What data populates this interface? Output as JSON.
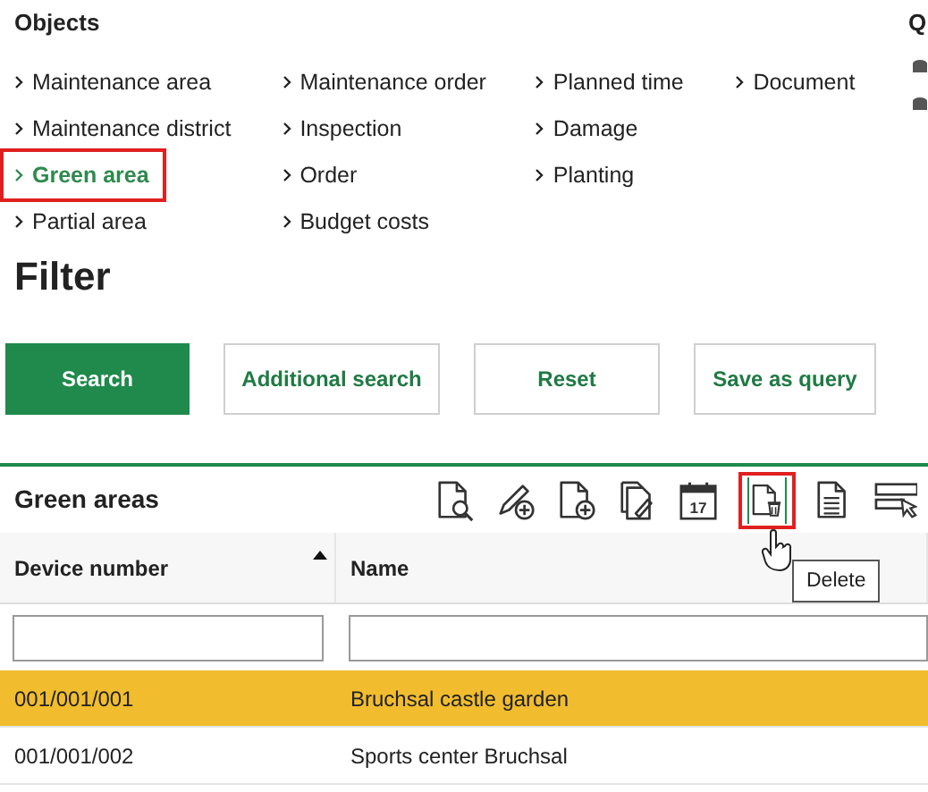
{
  "objects": {
    "heading": "Objects",
    "link_columns": [
      [
        {
          "label": "Maintenance area",
          "selected": false
        },
        {
          "label": "Maintenance district",
          "selected": false
        },
        {
          "label": "Green area",
          "selected": true
        },
        {
          "label": "Partial area",
          "selected": false
        }
      ],
      [
        {
          "label": "Maintenance order",
          "selected": false
        },
        {
          "label": "Inspection",
          "selected": false
        },
        {
          "label": "Order",
          "selected": false
        },
        {
          "label": "Budget costs",
          "selected": false
        }
      ],
      [
        {
          "label": "Planned time",
          "selected": false
        },
        {
          "label": "Damage",
          "selected": false
        },
        {
          "label": "Planting",
          "selected": false
        }
      ],
      [
        {
          "label": "Document",
          "selected": false
        }
      ]
    ]
  },
  "side_heading": "Q",
  "filter": {
    "title": "Filter",
    "buttons": [
      {
        "label": "Search",
        "kind": "primary"
      },
      {
        "label": "Additional search",
        "kind": "secondary"
      },
      {
        "label": "Reset",
        "kind": "secondary"
      },
      {
        "label": "Save as query",
        "kind": "secondary"
      }
    ]
  },
  "table": {
    "title": "Green areas",
    "toolbar": [
      {
        "kind": "view",
        "hovered": false
      },
      {
        "kind": "edit-add",
        "hovered": false
      },
      {
        "kind": "new",
        "hovered": false
      },
      {
        "kind": "copy",
        "hovered": false
      },
      {
        "kind": "calendar",
        "hovered": false
      },
      {
        "kind": "delete",
        "hovered": true
      },
      {
        "kind": "report",
        "hovered": false
      },
      {
        "kind": "select",
        "hovered": false
      }
    ],
    "calendar_day": "17",
    "tooltip": "Delete",
    "columns": [
      {
        "label": "Device number",
        "sorted": true
      },
      {
        "label": "Name",
        "sorted": false
      }
    ],
    "rows": [
      {
        "cells": [
          "001/001/001",
          "Bruchsal castle garden"
        ],
        "selected": true
      },
      {
        "cells": [
          "001/001/002",
          "Sports center Bruchsal"
        ],
        "selected": false
      }
    ]
  }
}
